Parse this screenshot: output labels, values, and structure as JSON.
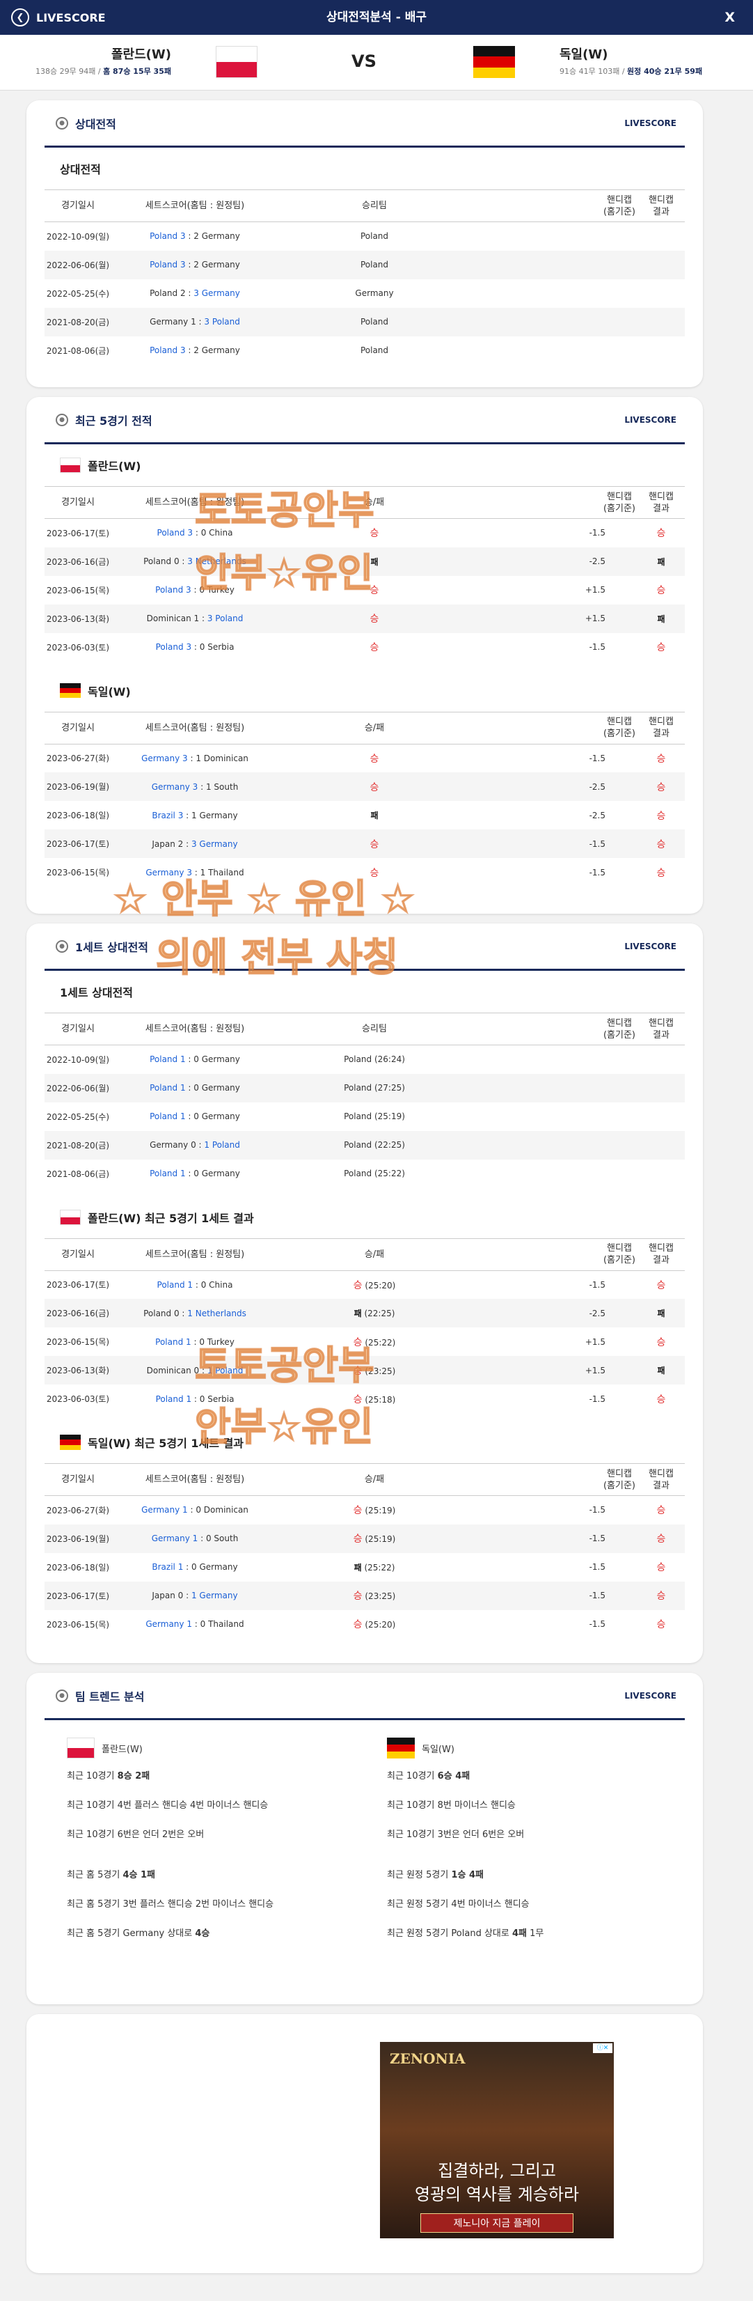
{
  "header": {
    "brand": "LIVESCORE",
    "title": "상대전적분석 - 배구",
    "close": "X"
  },
  "match": {
    "home": {
      "name": "폴란드(W)",
      "record_plain": "138승 29무 94패 / ",
      "record_bold": "홈 87승 15무 35패"
    },
    "away": {
      "name": "독일(W)",
      "record_plain": "91승 41무 103패 / ",
      "record_bold": "원정 40승 21무 59패"
    },
    "vs": "VS"
  },
  "brand_small": "LIVESCORE",
  "h2h": {
    "title": "상대전적",
    "subtitle": "상대전적",
    "headers": [
      "경기일시",
      "세트스코어(홈팀 : 원정팀)",
      "승리팀",
      "핸디캡(홈기준)",
      "핸디캡 결과"
    ],
    "rows": [
      {
        "date": "2022-10-09(일)",
        "a": "Poland 3",
        "b": " : 2 Germany",
        "w": "Poland"
      },
      {
        "date": "2022-06-06(월)",
        "a": "Poland 3",
        "b": " : 2 Germany",
        "w": "Poland"
      },
      {
        "date": "2022-05-25(수)",
        "a": "Poland 2 : ",
        "b": "3 Germany",
        "w": "Germany"
      },
      {
        "date": "2021-08-20(금)",
        "a": "Germany 1 : ",
        "b": "3 Poland",
        "w": "Poland"
      },
      {
        "date": "2021-08-06(금)",
        "a": "Poland 3",
        "b": " : 2 Germany",
        "w": "Poland"
      }
    ]
  },
  "recent": {
    "title": "최근 5경기 전적",
    "headers": [
      "경기일시",
      "세트스코어(홈팀 : 원정팀)",
      "승/패",
      "핸디캡(홈기준)",
      "핸디캡 결과"
    ],
    "home_title": "폴란드(W)",
    "home_rows": [
      {
        "date": "2023-06-17(토)",
        "a": "Poland 3",
        "b": " : 0 China",
        "r": "승",
        "h": "-1.5",
        "hr": "승"
      },
      {
        "date": "2023-06-16(금)",
        "a": "Poland 0 : ",
        "b": "3 Netherlands",
        "r": "패",
        "h": "-2.5",
        "hr": "패"
      },
      {
        "date": "2023-06-15(목)",
        "a": "Poland 3",
        "b": " : 0 Turkey",
        "r": "승",
        "h": "+1.5",
        "hr": "승"
      },
      {
        "date": "2023-06-13(화)",
        "a": "Dominican 1 : ",
        "b": "3 Poland",
        "r": "승",
        "h": "+1.5",
        "hr": "패"
      },
      {
        "date": "2023-06-03(토)",
        "a": "Poland 3",
        "b": " : 0 Serbia",
        "r": "승",
        "h": "-1.5",
        "hr": "승"
      }
    ],
    "away_title": "독일(W)",
    "away_rows": [
      {
        "date": "2023-06-27(화)",
        "a": "Germany 3",
        "b": " : 1 Dominican",
        "r": "승",
        "h": "-1.5",
        "hr": "승"
      },
      {
        "date": "2023-06-19(월)",
        "a": "Germany 3",
        "b": " : 1 South",
        "r": "승",
        "h": "-2.5",
        "hr": "승"
      },
      {
        "date": "2023-06-18(일)",
        "a": "Brazil 3",
        "b": " : 1 Germany",
        "r": "패",
        "h": "-2.5",
        "hr": "승"
      },
      {
        "date": "2023-06-17(토)",
        "a": "Japan 2 : ",
        "b": "3 Germany",
        "r": "승",
        "h": "-1.5",
        "hr": "승"
      },
      {
        "date": "2023-06-15(목)",
        "a": "Germany 3",
        "b": " : 1 Thailand",
        "r": "승",
        "h": "-1.5",
        "hr": "승"
      }
    ]
  },
  "set1": {
    "title": "1세트 상대전적",
    "subtitle": "1세트 상대전적",
    "rows": [
      {
        "date": "2022-10-09(일)",
        "a": "Poland 1",
        "b": " : 0 Germany",
        "w": "Poland (26:24)"
      },
      {
        "date": "2022-06-06(월)",
        "a": "Poland 1",
        "b": " : 0 Germany",
        "w": "Poland (27:25)"
      },
      {
        "date": "2022-05-25(수)",
        "a": "Poland 1",
        "b": " : 0 Germany",
        "w": "Poland (25:19)"
      },
      {
        "date": "2021-08-20(금)",
        "a": "Germany 0 : ",
        "b": "1 Poland",
        "w": "Poland (22:25)"
      },
      {
        "date": "2021-08-06(금)",
        "a": "Poland 1",
        "b": " : 0 Germany",
        "w": "Poland (25:22)"
      }
    ],
    "home_title": "폴란드(W) 최근 5경기 1세트 결과",
    "home_rows": [
      {
        "date": "2023-06-17(토)",
        "a": "Poland 1",
        "b": " : 0 China",
        "r": "승",
        "s": " (25:20)",
        "h": "-1.5",
        "hr": "승"
      },
      {
        "date": "2023-06-16(금)",
        "a": "Poland 0 : ",
        "b": "1 Netherlands",
        "r": "패",
        "s": " (22:25)",
        "h": "-2.5",
        "hr": "패"
      },
      {
        "date": "2023-06-15(목)",
        "a": "Poland 1",
        "b": " : 0 Turkey",
        "r": "승",
        "s": " (25:22)",
        "h": "+1.5",
        "hr": "승"
      },
      {
        "date": "2023-06-13(화)",
        "a": "Dominican 0 : ",
        "b": "1 Poland",
        "r": "승",
        "s": " (23:25)",
        "h": "+1.5",
        "hr": "패"
      },
      {
        "date": "2023-06-03(토)",
        "a": "Poland 1",
        "b": " : 0 Serbia",
        "r": "승",
        "s": " (25:18)",
        "h": "-1.5",
        "hr": "승"
      }
    ],
    "away_title": "독일(W) 최근 5경기 1세트 결과",
    "away_rows": [
      {
        "date": "2023-06-27(화)",
        "a": "Germany 1",
        "b": " : 0 Dominican",
        "r": "승",
        "s": " (25:19)",
        "h": "-1.5",
        "hr": "승"
      },
      {
        "date": "2023-06-19(월)",
        "a": "Germany 1",
        "b": " : 0 South",
        "r": "승",
        "s": " (25:19)",
        "h": "-1.5",
        "hr": "승"
      },
      {
        "date": "2023-06-18(일)",
        "a": "Brazil 1",
        "b": " : 0 Germany",
        "r": "패",
        "s": " (25:22)",
        "h": "-1.5",
        "hr": "승"
      },
      {
        "date": "2023-06-17(토)",
        "a": "Japan 0 : ",
        "b": "1 Germany",
        "r": "승",
        "s": " (23:25)",
        "h": "-1.5",
        "hr": "승"
      },
      {
        "date": "2023-06-15(목)",
        "a": "Germany 1",
        "b": " : 0 Thailand",
        "r": "승",
        "s": " (25:20)",
        "h": "-1.5",
        "hr": "승"
      }
    ]
  },
  "trend": {
    "title": "팀 트렌드 분석",
    "home": {
      "name": "폴란드(W)",
      "lines": [
        [
          "최근 10경기 ",
          "8승 2패",
          ""
        ],
        [
          "최근 10경기 4번 플러스 핸디승 4번 마이너스 핸디승",
          "",
          ""
        ],
        [
          "최근 10경기 6번은 언더 2번은 오버",
          "",
          ""
        ],
        [
          "최근 홈 5경기 ",
          "4승 1패",
          ""
        ],
        [
          "최근 홈 5경기 3번 플러스 핸디승 2번 마이너스 핸디승",
          "",
          ""
        ],
        [
          "최근 홈 5경기 Germany 상대로 ",
          "4승",
          ""
        ]
      ]
    },
    "away": {
      "name": "독일(W)",
      "lines": [
        [
          "최근 10경기 ",
          "6승 4패",
          ""
        ],
        [
          "최근 10경기 8번 마이너스 핸디승",
          "",
          ""
        ],
        [
          "최근 10경기 3번은 언더 6번은 오버",
          "",
          ""
        ],
        [
          "최근 원정 5경기 ",
          "1승 4패",
          ""
        ],
        [
          "최근 원정 5경기 4번 마이너스 핸디승",
          "",
          ""
        ],
        [
          "최근 원정 5경기 Poland 상대로 ",
          "4패",
          " 1무"
        ]
      ]
    }
  },
  "ad": {
    "logo": "ZENONIA",
    "close": "ⓘ✕",
    "line1": "집결하라, 그리고",
    "line2": "영광의 역사를 계승하라",
    "button": "제노니아 지금 플레이"
  },
  "watermarks": [
    "토토공안부",
    "안부☆유인",
    "☆ 안부 ☆ 유인 ☆",
    "의에 전부 사칭",
    "토토공안부",
    "안부☆유인"
  ]
}
